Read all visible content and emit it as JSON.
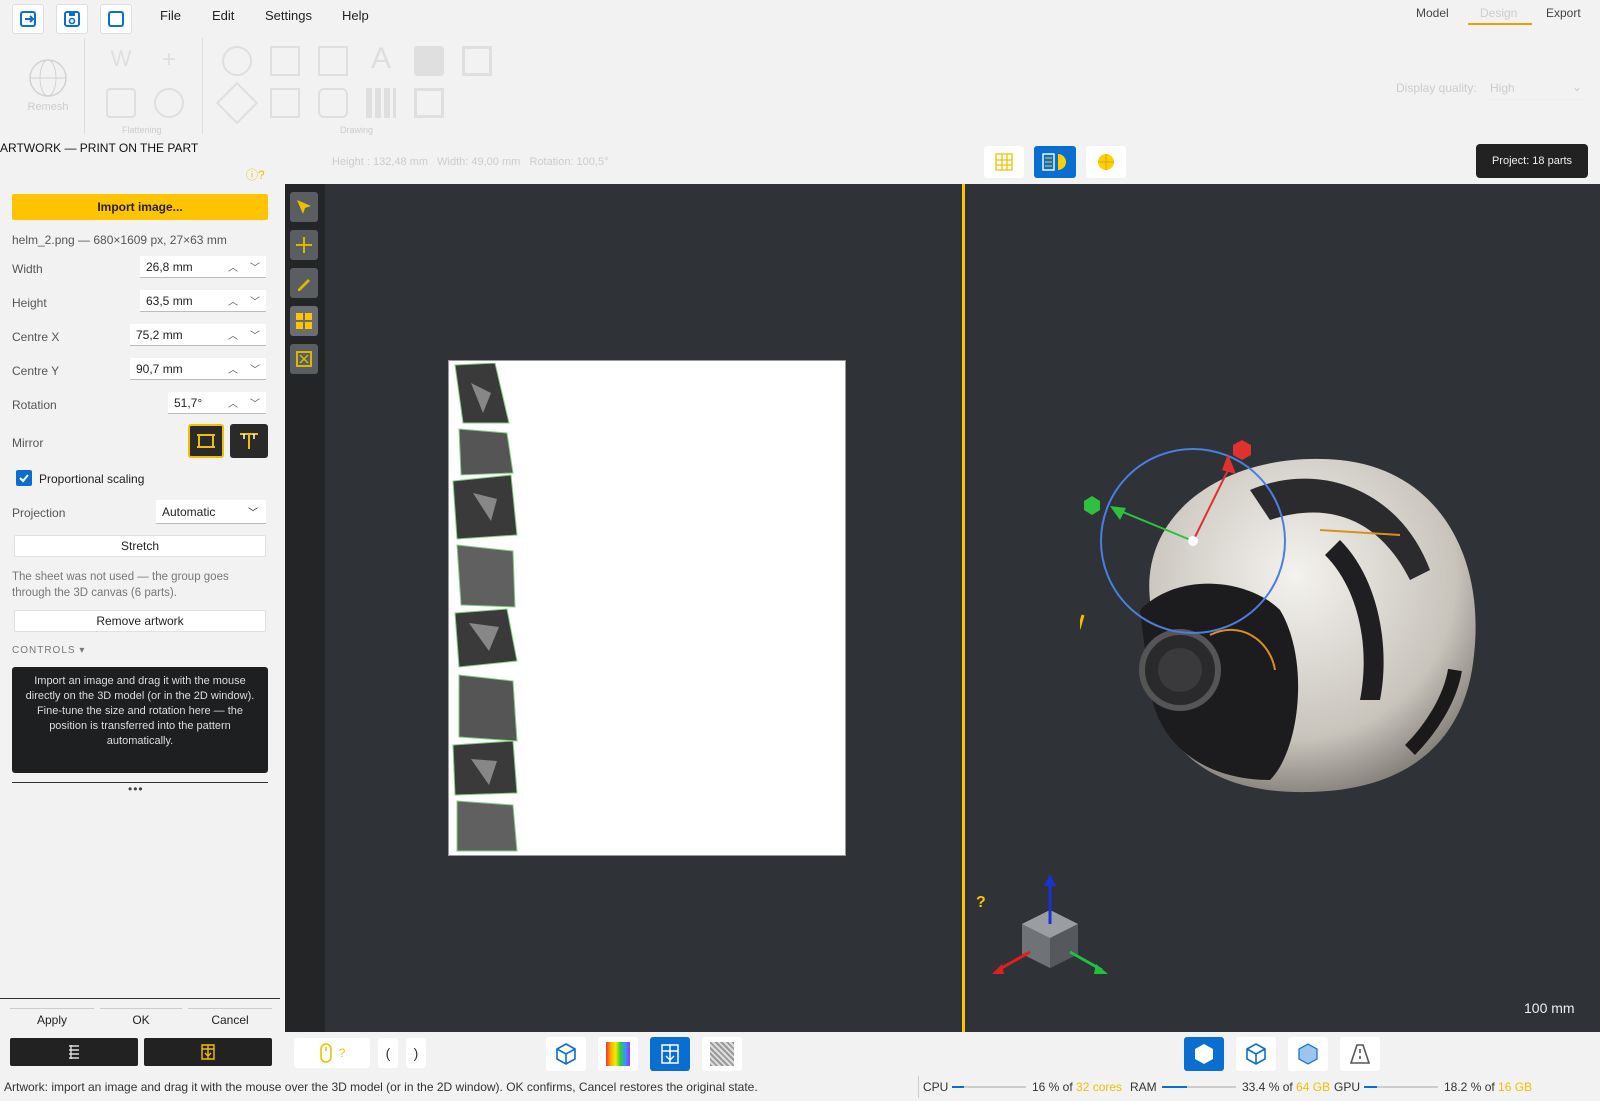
{
  "menu": {
    "file": "File",
    "edit": "Edit",
    "settings": "Settings",
    "help": "Help"
  },
  "tabs": {
    "model": "Model",
    "design": "Design",
    "export": "Export"
  },
  "ribbon": {
    "remesh": "Remesh",
    "flattening": "Flattening",
    "drawing": "Drawing",
    "display_quality_label": "Display quality:",
    "display_quality_value": "High"
  },
  "panel": {
    "title": "ARTWORK — PRINT ON THE PART",
    "import_btn": "Import image...",
    "file_info": "helm_2.png — 680×1609 px, 27×63 mm",
    "width_label": "Width",
    "width_value": "26,8 mm",
    "height_label": "Height",
    "height_value": "63,5 mm",
    "cx_label": "Centre X",
    "cx_value": "75,2 mm",
    "cy_label": "Centre Y",
    "cy_value": "90,7 mm",
    "rot_label": "Rotation",
    "rot_value": "51,7°",
    "mirror_label": "Mirror",
    "prop_label": "Proportional scaling",
    "proj_label": "Projection",
    "proj_value": "Automatic",
    "stretch_btn": "Stretch",
    "note": "The sheet was not used — the group goes through the 3D canvas (6 parts).",
    "remove_btn": "Remove artwork",
    "controls_label": "CONTROLS",
    "controls_text": "Import an image and drag it with the mouse directly on the 3D model (or in the 2D window). Fine-tune the size and rotation here — the position is transferred into the pattern automatically.",
    "apply": "Apply",
    "ok": "OK",
    "cancel": "Cancel"
  },
  "info_bar": "Height : 132,48 mm   Width: 49,00 mm   Rotation: 100,5°",
  "project_badge": "Project: 18 parts",
  "viewport": {
    "scale_label": "100 mm",
    "help_mark": "?"
  },
  "bottom": {
    "mouse_hint": "?",
    "bracket_open": "(",
    "bracket_close": ")"
  },
  "status": {
    "message": "Artwork: import an image and drag it with the mouse over the 3D model (or in the 2D window). OK confirms, Cancel restores the original state.",
    "cpu_label": "CPU",
    "cpu_value": "16 % of ",
    "cpu_total": "32 cores",
    "cpu_level": 0.16,
    "ram_label": "RAM",
    "ram_value": "33.4 % of ",
    "ram_total": "64 GB",
    "ram_level": 0.334,
    "gpu_label": "GPU",
    "gpu_value": "18.2 % of ",
    "gpu_total": "16 GB",
    "gpu_level": 0.182
  },
  "colors": {
    "accent": "#ffc400",
    "blue": "#0a6ed1",
    "viewport_bg": "#2f3236"
  }
}
